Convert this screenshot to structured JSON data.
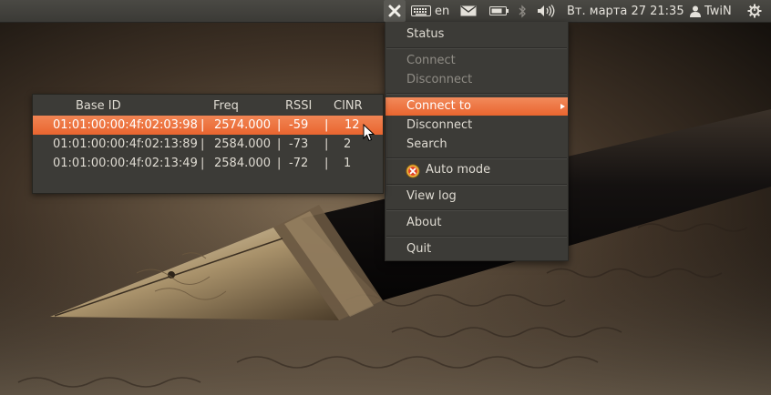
{
  "panel": {
    "keyboard_layout": "en",
    "clock": "Вт. марта 27 21:35",
    "user": "TwiN",
    "icons": [
      "app-indicator-x-icon",
      "keyboard-icon",
      "mail-icon",
      "battery-icon",
      "bluetooth-icon",
      "volume-icon",
      "user-icon",
      "session-gear-icon"
    ]
  },
  "menu": {
    "status": "Status",
    "connect_disabled": "Connect",
    "disconnect_disabled": "Disconnect",
    "connect_to": "Connect to",
    "disconnect": "Disconnect",
    "search": "Search",
    "auto_mode": "Auto mode",
    "view_log": "View log",
    "about": "About",
    "quit": "Quit"
  },
  "base_stations": {
    "columns": [
      "Base ID",
      "Freq",
      "RSSI",
      "CINR"
    ],
    "separator": "|",
    "rows": [
      {
        "id": "01:01:00:00:4f:02:03:98",
        "freq": "2574.000",
        "rssi": "-59",
        "cinr": "12",
        "selected": true
      },
      {
        "id": "01:01:00:00:4f:02:13:89",
        "freq": "2584.000",
        "rssi": "-73",
        "cinr": "2",
        "selected": false
      },
      {
        "id": "01:01:00:00:4f:02:13:49",
        "freq": "2584.000",
        "rssi": "-72",
        "cinr": "1",
        "selected": false
      }
    ]
  },
  "colors": {
    "accent": "#e9652f",
    "panel": "#3c3b37",
    "text": "#dfdbd2",
    "disabled_text": "#8f8c85"
  }
}
